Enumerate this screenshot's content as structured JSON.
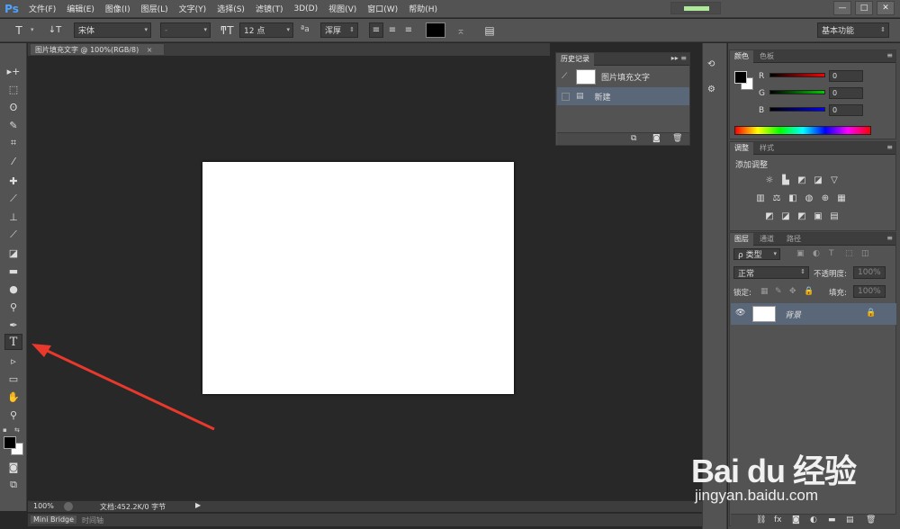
{
  "app": {
    "logo": "Ps"
  },
  "menu": [
    "文件(F)",
    "编辑(E)",
    "图像(I)",
    "图层(L)",
    "文字(Y)",
    "选择(S)",
    "滤镜(T)",
    "3D(D)",
    "视图(V)",
    "窗口(W)",
    "帮助(H)"
  ],
  "window_buttons": [
    "—",
    "□",
    "✕"
  ],
  "options": {
    "font_family": "宋体",
    "font_style": "-",
    "font_size": "12 点",
    "aa_label": "ªa",
    "antialias": "浑厚",
    "workspace": "基本功能",
    "text_color": "#000000"
  },
  "document": {
    "tab_title": "图片填充文字 @ 100%(RGB/8)",
    "tab_close": "×",
    "zoom": "100%",
    "doc_info": "文档:452.2K/0 字节"
  },
  "bottom_tabs": [
    "Mini Bridge",
    "时间轴"
  ],
  "history": {
    "tab": "历史记录",
    "snapshot_name": "图片填充文字",
    "items": [
      "新建"
    ]
  },
  "color_panel": {
    "tabs": [
      "颜色",
      "色板"
    ],
    "channels": [
      {
        "label": "R",
        "value": "0",
        "color": "#ff0000"
      },
      {
        "label": "G",
        "value": "0",
        "color": "#00cc00"
      },
      {
        "label": "B",
        "value": "0",
        "color": "#0000ff"
      }
    ]
  },
  "adjust_panel": {
    "tabs": [
      "调整",
      "样式"
    ],
    "title": "添加调整"
  },
  "layers_panel": {
    "tabs": [
      "图层",
      "通道",
      "路径"
    ],
    "filter": "ρ 类型",
    "blend_mode": "正常",
    "opacity_label": "不透明度:",
    "opacity": "100%",
    "lock_label": "锁定:",
    "fill_label": "填充:",
    "fill": "100%",
    "layers": [
      {
        "name": "背景"
      }
    ]
  },
  "watermark": {
    "logo": "Bai du 经验",
    "url": "jingyan.baidu.com"
  },
  "colors": {
    "arrow": "#e8392c",
    "selected_row": "#596779",
    "panel_bg": "#535353"
  }
}
